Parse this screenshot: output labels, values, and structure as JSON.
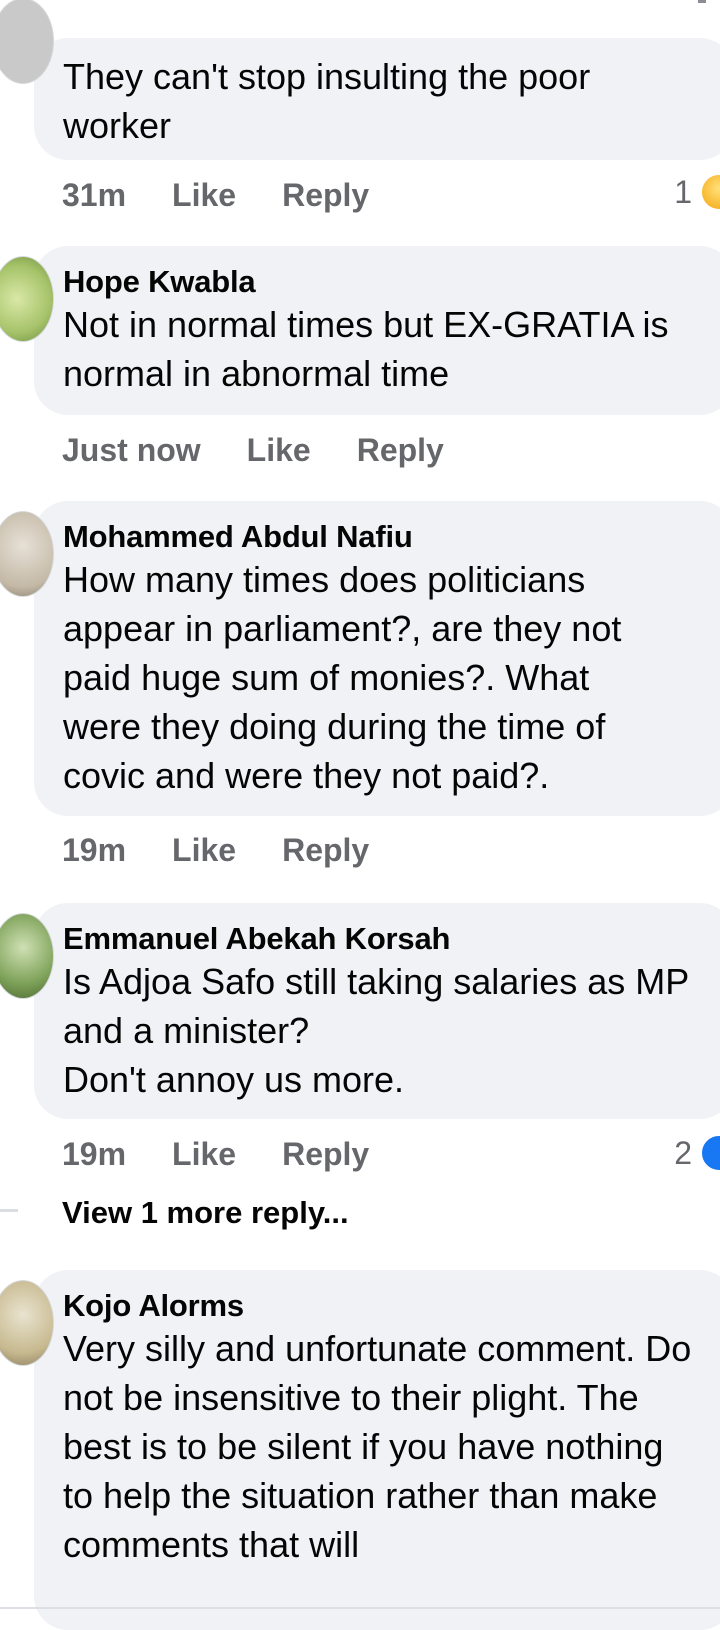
{
  "comments": [
    {
      "author": "",
      "text": "They can't stop insulting the poor worker",
      "time": "31m",
      "like": "Like",
      "reply": "Reply",
      "reaction_count": "1",
      "reaction_icon": "haha-icon"
    },
    {
      "author": "Hope Kwabla",
      "text": "Not in normal times but EX-GRATIA is normal in abnormal time",
      "time": "Just now",
      "like": "Like",
      "reply": "Reply"
    },
    {
      "author": "Mohammed Abdul Nafiu",
      "text": "How many times does politicians appear in parliament?, are they not paid huge sum of monies?. What were they doing during the time of covic and were they not paid?.",
      "time": "19m",
      "like": "Like",
      "reply": "Reply"
    },
    {
      "author": "Emmanuel Abekah Korsah",
      "text": "Is Adjoa Safo still taking salaries as MP and a minister?\nDon't annoy us more.",
      "time": "19m",
      "like": "Like",
      "reply": "Reply",
      "reaction_count": "2",
      "reaction_icon": "like-icon",
      "view_more": "View 1 more reply..."
    },
    {
      "author": "Kojo Alorms",
      "text": "Very silly and unfortunate comment. Do not be insensitive to their plight. The best is to be silent if you have nothing to help the situation rather than make comments that will"
    }
  ],
  "colors": {
    "bubble": "#f0f2f5",
    "meta_text": "#65676b",
    "like_blue": "#1877f2"
  }
}
